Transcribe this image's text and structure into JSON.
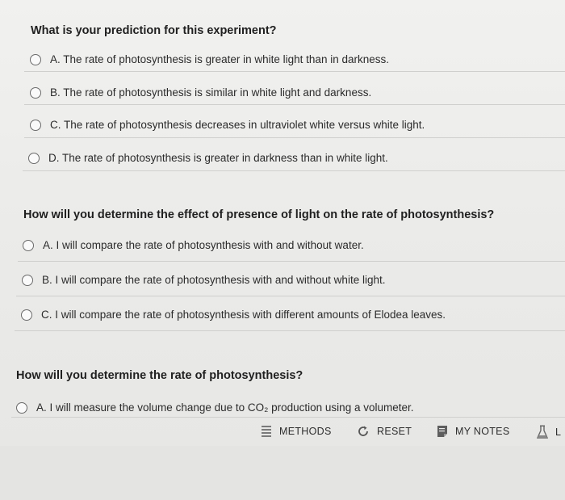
{
  "q1": {
    "title": "What is your prediction for this experiment?",
    "options": [
      "A. The rate of photosynthesis is greater in white light than in darkness.",
      "B. The rate of photosynthesis is similar in white light and darkness.",
      "C. The rate of photosynthesis decreases in ultraviolet white versus white light.",
      "D. The rate of photosynthesis is greater in darkness than in white light."
    ]
  },
  "q2": {
    "title": "How will you determine the effect of presence of light on the rate of photosynthesis?",
    "options": [
      "A. I will compare the rate of photosynthesis with and without water.",
      "B. I will compare the rate of photosynthesis with and without white light.",
      "C. I will compare the rate of photosynthesis with different amounts of Elodea leaves."
    ]
  },
  "q3": {
    "title": "How will you determine the rate of photosynthesis?",
    "options": [
      "A. I will measure the volume change due to CO₂ production using a volumeter."
    ]
  },
  "toolbar": {
    "methods": "METHODS",
    "reset": "RESET",
    "my_notes": "MY NOTES",
    "lab_data": "L"
  },
  "icons": {
    "methods": "list-icon",
    "reset": "reset-icon",
    "my_notes": "notes-icon",
    "lab_data": "flask-icon"
  }
}
